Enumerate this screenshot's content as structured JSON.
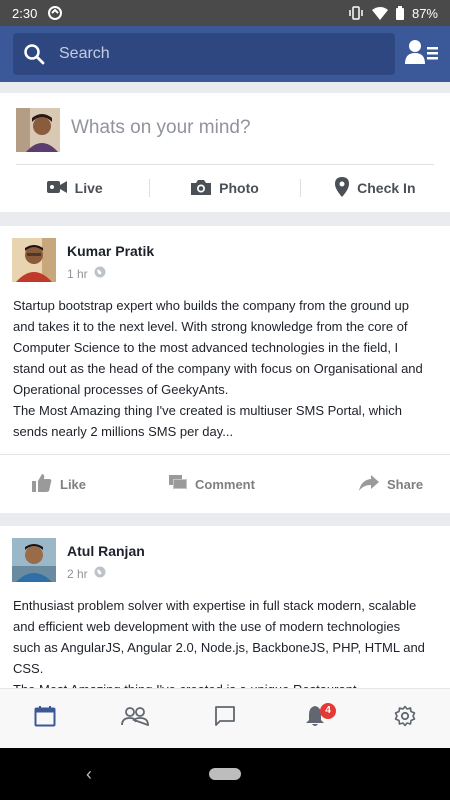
{
  "status_bar": {
    "time": "2:30",
    "battery": "87%"
  },
  "search": {
    "placeholder": "Search"
  },
  "composer": {
    "prompt": "Whats on your mind?",
    "actions": [
      {
        "label": "Live",
        "icon": "video-icon"
      },
      {
        "label": "Photo",
        "icon": "camera-icon"
      },
      {
        "label": "Check In",
        "icon": "location-pin-icon"
      }
    ]
  },
  "posts": [
    {
      "author": "Kumar Pratik",
      "time": "1 hr",
      "body_lines": [
        "Startup bootstrap expert who builds the company from the ground up",
        "and takes it to the next level. With strong knowledge from the core of",
        "Computer Science to the most advanced technologies in the field, I",
        "stand out as the head of the company with focus on Organisational and",
        "Operational processes of GeekyAnts.",
        "The Most Amazing thing I've created is multiuser SMS Portal, which",
        "sends nearly 2 millions SMS per day..."
      ],
      "actions": {
        "like": "Like",
        "comment": "Comment",
        "share": "Share"
      }
    },
    {
      "author": "Atul Ranjan",
      "time": "2 hr",
      "body_lines": [
        "Enthusiast problem solver with expertise in full stack modern, scalable",
        "and efficient web development with the use of modern technologies",
        "such as AngularJS, Angular 2.0, Node.js, BackboneJS, PHP, HTML and",
        "CSS.",
        "The Most Amazing thing I've created is a unique Restaurant"
      ]
    }
  ],
  "tab_bar": {
    "tabs": [
      "calendar-icon",
      "people-icon",
      "chat-icon",
      "bell-icon",
      "settings-icon"
    ],
    "notification_count": "4",
    "active_color": "#3b5998"
  }
}
